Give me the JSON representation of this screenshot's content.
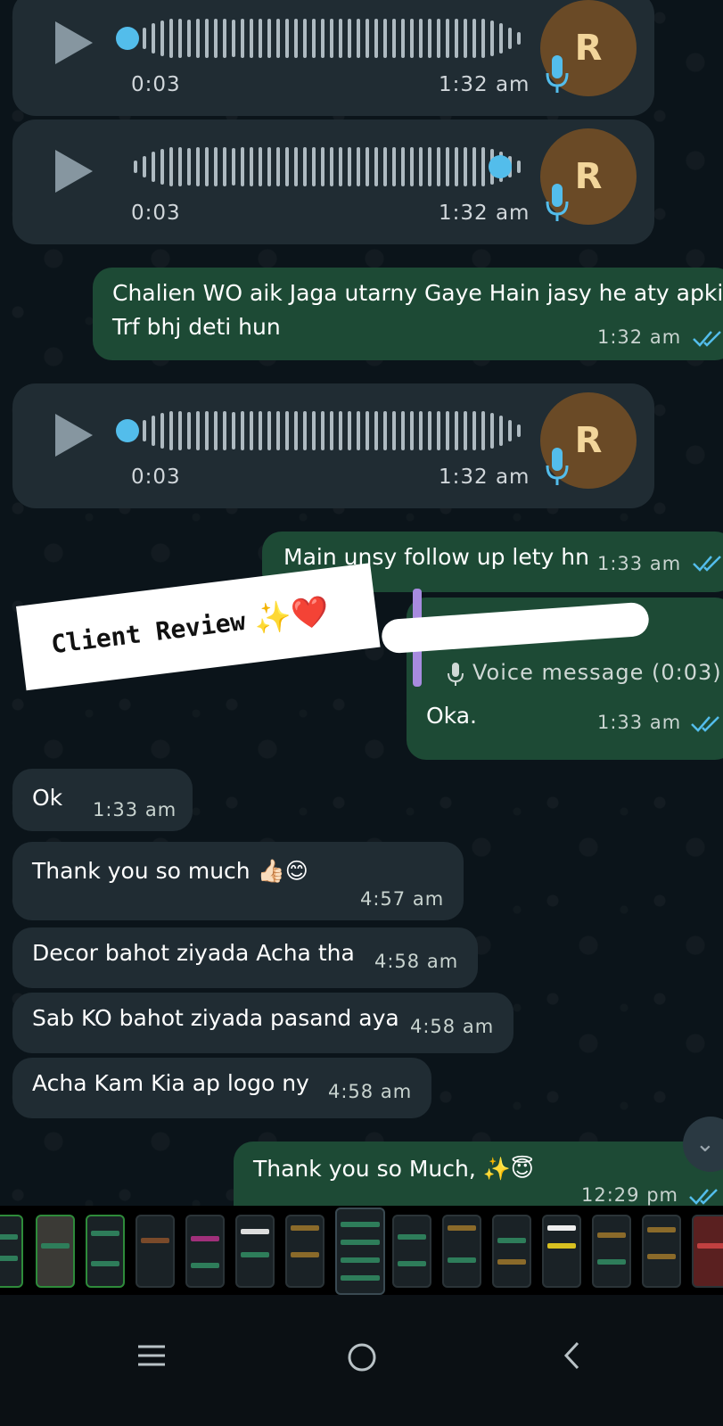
{
  "voice_messages": [
    {
      "duration": "0:03",
      "time": "1:32 am",
      "avatar_letter": "R",
      "progress": 0.0
    },
    {
      "duration": "0:03",
      "time": "1:32 am",
      "avatar_letter": "R",
      "progress": 1.0
    },
    {
      "duration": "0:03",
      "time": "1:32 am",
      "avatar_letter": "R",
      "progress": 0.0
    }
  ],
  "messages": {
    "out_1": {
      "text_line1": "Chalien WO aik Jaga utarny Gaye Hain jasy he aty apki",
      "text_line2": "Trf bhj deti hun",
      "time": "1:32 am"
    },
    "out_2": {
      "text": "Main unsy follow up lety hn",
      "time": "1:33 am"
    },
    "out_reply": {
      "quoted_label": "Voice message (0:03)",
      "text": "Oka.",
      "time": "1:33 am"
    },
    "in_1": {
      "text": "Ok",
      "time": "1:33 am"
    },
    "in_2": {
      "text": "Thank you so much 👍🏻😊",
      "time": "4:57 am"
    },
    "in_3": {
      "text": "Decor bahot ziyada Acha tha",
      "time": "4:58 am"
    },
    "in_4": {
      "text": "Sab KO bahot ziyada pasand aya",
      "time": "4:58 am"
    },
    "in_5": {
      "text": "Acha Kam Kia ap logo ny",
      "time": "4:58 am"
    },
    "out_3": {
      "text": "Thank you so Much, ✨😇",
      "time": "12:29 pm"
    }
  },
  "sticker": {
    "label": "Client Review",
    "emoji": "✨❤️"
  },
  "colors": {
    "chat_bg": "#0b141a",
    "incoming_bubble": "#202c33",
    "outgoing_bubble": "#1d4a35",
    "read_ticks": "#53bdeb",
    "voice_dot": "#53bdeb",
    "avatar_bg": "#6a4a26"
  },
  "icons": {
    "play": "play-icon",
    "mic": "microphone-icon",
    "ticks": "double-check-icon",
    "scroll": "chevron-double-down-icon",
    "nav_recents": "recents-icon",
    "nav_home": "home-icon",
    "nav_back": "back-icon"
  }
}
